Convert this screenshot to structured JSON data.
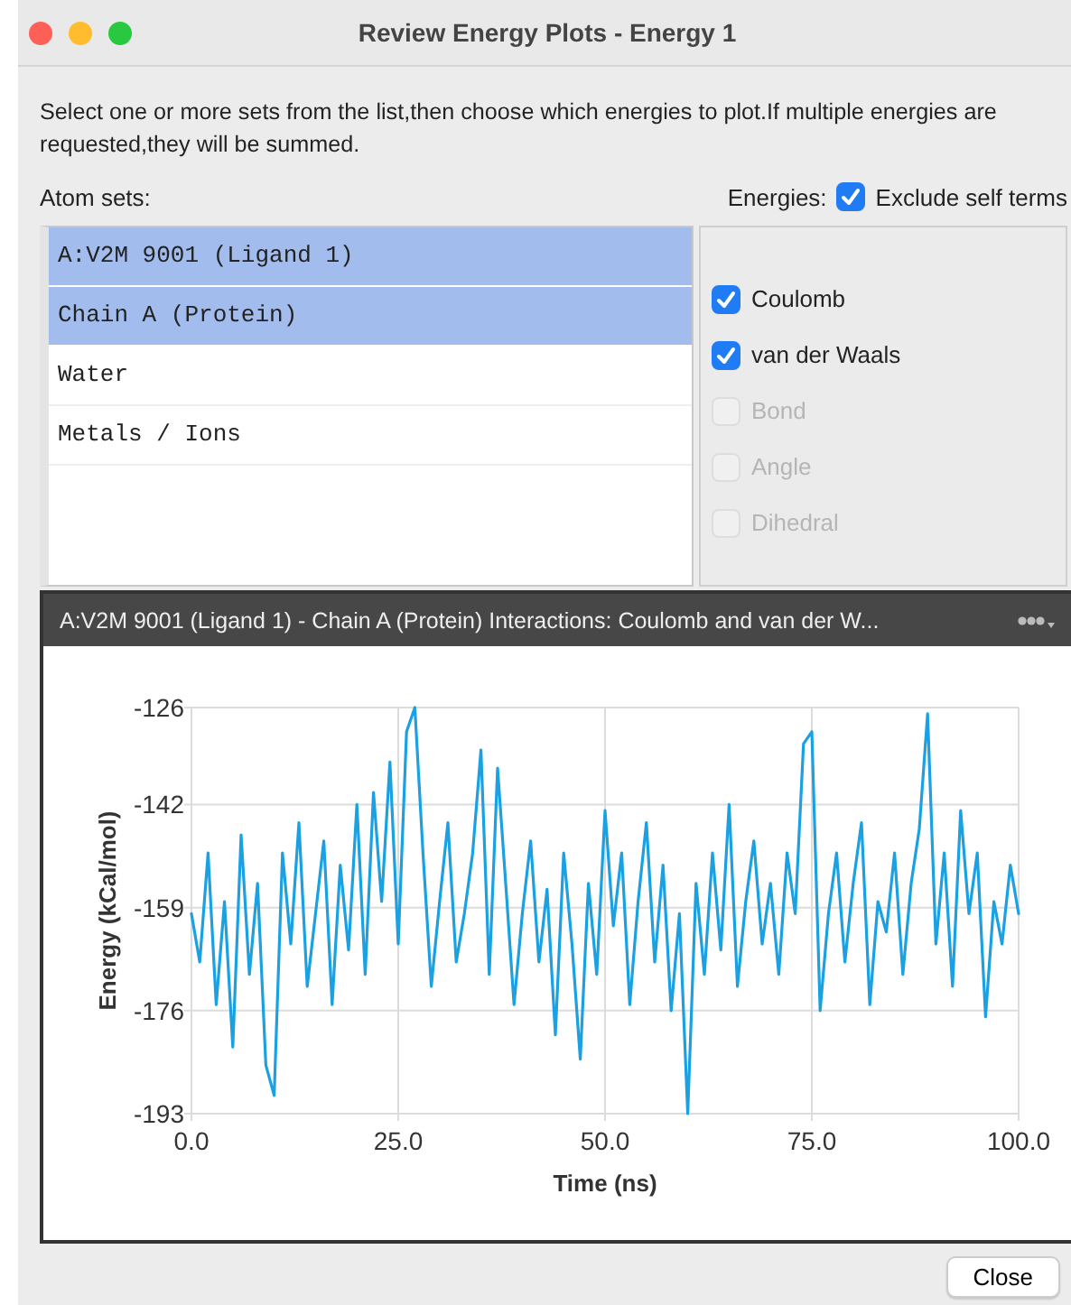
{
  "window": {
    "title": "Review Energy Plots - Energy 1"
  },
  "instructions": "Select one or more sets from the list,then choose which energies to plot.If multiple energies are requested,they will be summed.",
  "atom_sets": {
    "label": "Atom sets:",
    "items": [
      {
        "label": "A:V2M 9001 (Ligand 1)",
        "selected": true
      },
      {
        "label": "Chain A (Protein)",
        "selected": true
      },
      {
        "label": "Water",
        "selected": false
      },
      {
        "label": "Metals / Ions",
        "selected": false
      }
    ]
  },
  "energies": {
    "label": "Energies:",
    "exclude_self_terms": {
      "label": "Exclude self terms",
      "checked": true
    },
    "items": [
      {
        "label": "Coulomb",
        "checked": true,
        "disabled": false
      },
      {
        "label": "van der Waals",
        "checked": true,
        "disabled": false
      },
      {
        "label": "Bond",
        "checked": false,
        "disabled": true
      },
      {
        "label": "Angle",
        "checked": false,
        "disabled": true
      },
      {
        "label": "Dihedral",
        "checked": false,
        "disabled": true
      }
    ]
  },
  "plot_panel": {
    "title": "A:V2M 9001 (Ligand 1) - Chain A (Protein) Interactions: Coulomb and van der W...",
    "chart_data": {
      "type": "line",
      "grid": true,
      "xlabel": "Time (ns)",
      "ylabel": "Energy (kCal/mol)",
      "xlim": [
        0,
        100
      ],
      "ylim": [
        -193,
        -126
      ],
      "xticks": [
        {
          "value": 0,
          "label": "0.0"
        },
        {
          "value": 25,
          "label": "25.0"
        },
        {
          "value": 50,
          "label": "50.0"
        },
        {
          "value": 75,
          "label": "75.0"
        },
        {
          "value": 100,
          "label": "100.0"
        }
      ],
      "yticks": [
        {
          "value": -126,
          "label": "-126"
        },
        {
          "value": -142,
          "label": "-142"
        },
        {
          "value": -159,
          "label": "-159"
        },
        {
          "value": -176,
          "label": "-176"
        },
        {
          "value": -193,
          "label": "-193"
        }
      ],
      "x": [
        0,
        1,
        2,
        3,
        4,
        5,
        6,
        7,
        8,
        9,
        10,
        11,
        12,
        13,
        14,
        15,
        16,
        17,
        18,
        19,
        20,
        21,
        22,
        23,
        24,
        25,
        26,
        27,
        28,
        29,
        30,
        31,
        32,
        33,
        34,
        35,
        36,
        37,
        38,
        39,
        40,
        41,
        42,
        43,
        44,
        45,
        46,
        47,
        48,
        49,
        50,
        51,
        52,
        53,
        54,
        55,
        56,
        57,
        58,
        59,
        60,
        61,
        62,
        63,
        64,
        65,
        66,
        67,
        68,
        69,
        70,
        71,
        72,
        73,
        74,
        75,
        76,
        77,
        78,
        79,
        80,
        81,
        82,
        83,
        84,
        85,
        86,
        87,
        88,
        89,
        90,
        91,
        92,
        93,
        94,
        95,
        96,
        97,
        98,
        99,
        100
      ],
      "series": [
        {
          "color": "#1ba1e2",
          "values": [
            -160,
            -168,
            -150,
            -175,
            -158,
            -182,
            -147,
            -170,
            -155,
            -185,
            -190,
            -150,
            -165,
            -145,
            -172,
            -160,
            -148,
            -175,
            -152,
            -166,
            -142,
            -170,
            -140,
            -158,
            -135,
            -165,
            -130,
            -126,
            -150,
            -172,
            -158,
            -145,
            -168,
            -160,
            -150,
            -133,
            -170,
            -136,
            -155,
            -175,
            -160,
            -148,
            -168,
            -156,
            -180,
            -150,
            -165,
            -184,
            -155,
            -170,
            -143,
            -162,
            -150,
            -175,
            -158,
            -145,
            -168,
            -152,
            -176,
            -160,
            -193,
            -155,
            -170,
            -150,
            -166,
            -142,
            -172,
            -158,
            -148,
            -165,
            -155,
            -170,
            -150,
            -160,
            -132,
            -130,
            -176,
            -160,
            -150,
            -168,
            -155,
            -145,
            -175,
            -158,
            -163,
            -150,
            -170,
            -155,
            -146,
            -127,
            -165,
            -150,
            -172,
            -143,
            -160,
            -150,
            -177,
            -158,
            -165,
            -152,
            -160
          ]
        }
      ]
    }
  },
  "buttons": [
    {
      "label": "Close"
    }
  ]
}
